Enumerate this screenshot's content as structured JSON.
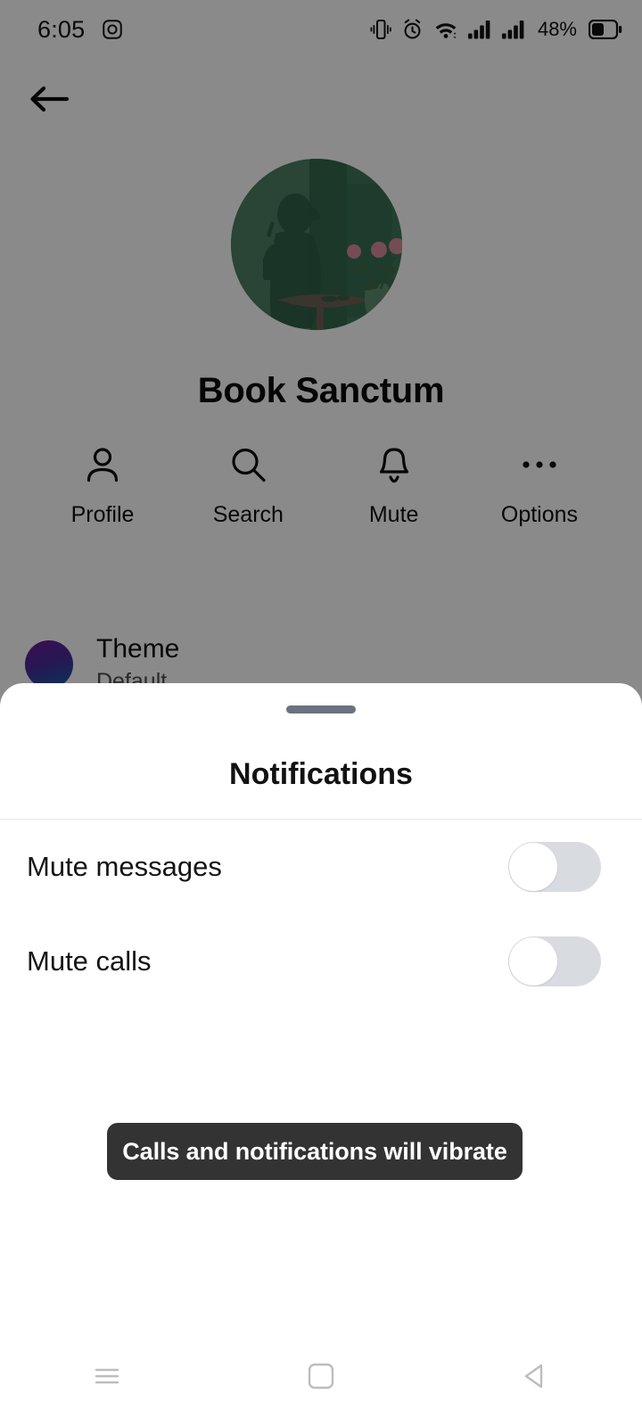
{
  "status_bar": {
    "clock": "6:05",
    "battery_percent": "48%",
    "icons": [
      "instagram-icon",
      "vibrate-icon",
      "alarm-icon",
      "wifi-icon",
      "signal-icon-1",
      "signal-icon-2",
      "battery-icon"
    ]
  },
  "header": {
    "back_icon": "back-arrow-icon"
  },
  "profile": {
    "name": "Book Sanctum",
    "avatar_description": "green room with person silhouette and flower vase"
  },
  "quick_actions": [
    {
      "label": "Profile",
      "icon": "person-icon"
    },
    {
      "label": "Search",
      "icon": "search-icon"
    },
    {
      "label": "Mute",
      "icon": "bell-icon"
    },
    {
      "label": "Options",
      "icon": "more-horizontal-icon"
    }
  ],
  "theme_row": {
    "title": "Theme",
    "subtitle": "Default",
    "swatch_colors": [
      "#6d1b9c",
      "#0f5fa8"
    ]
  },
  "bottom_sheet": {
    "title": "Notifications",
    "rows": [
      {
        "label": "Mute messages",
        "value": "off"
      },
      {
        "label": "Mute calls",
        "value": "off"
      }
    ]
  },
  "toast": {
    "message": "Calls and notifications will vibrate",
    "background": "#333333"
  },
  "nav_bar": [
    {
      "icon": "recents-menu-icon"
    },
    {
      "icon": "home-square-icon"
    },
    {
      "icon": "back-triangle-icon"
    }
  ]
}
